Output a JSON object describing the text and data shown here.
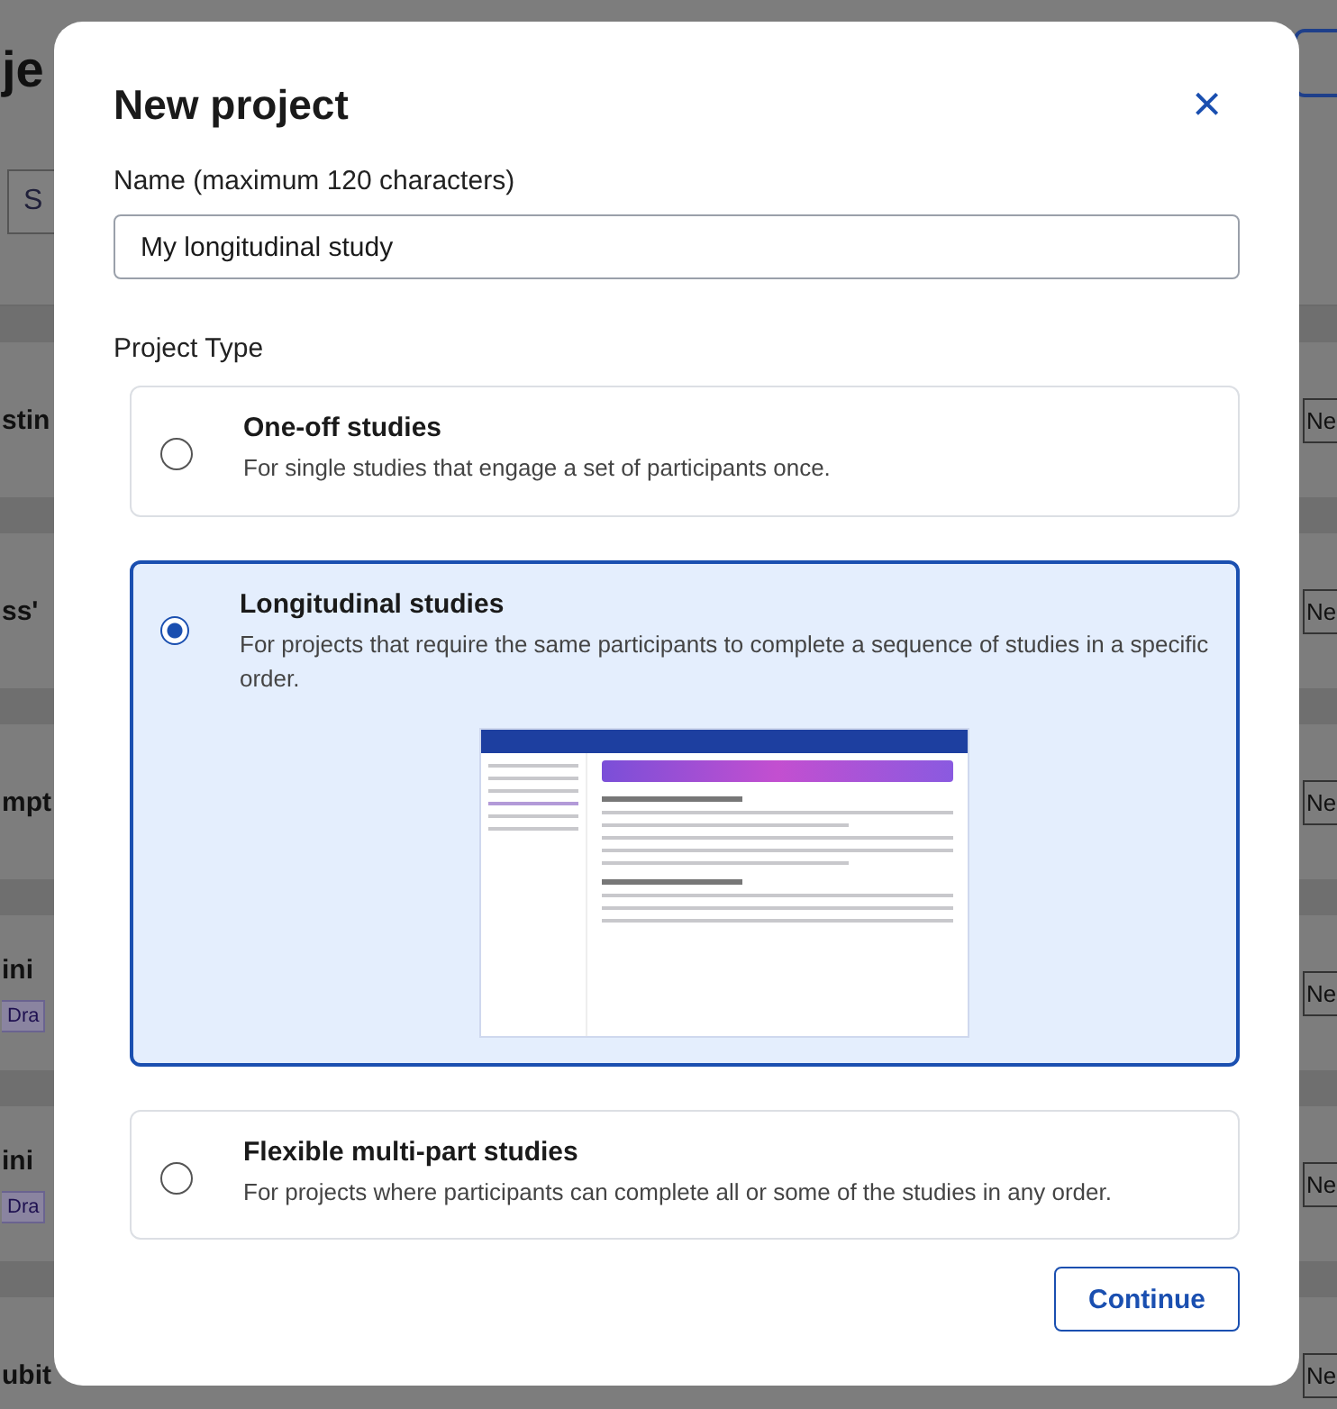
{
  "background": {
    "title": "je",
    "search": {
      "placeholder": "S"
    },
    "rows": [
      {
        "name": "stin",
        "status": "Ne"
      },
      {
        "name": "ss'",
        "status": "Ne"
      },
      {
        "name": "mpt",
        "status": "Ne"
      },
      {
        "name": "ini",
        "badge": "Dra",
        "status": "Ne"
      },
      {
        "name": "ini",
        "badge": "Dra",
        "status": "Ne"
      },
      {
        "name": "ubit",
        "status": "Ne"
      }
    ]
  },
  "dialog": {
    "title": "New project",
    "close": "×",
    "name_field": {
      "label": "Name (maximum 120 characters)",
      "value": "My longitudinal study"
    },
    "type_label": "Project Type",
    "options": [
      {
        "title": "One-off studies",
        "description": "For single studies that engage a set of participants once.",
        "selected": false
      },
      {
        "title": "Longitudinal studies",
        "description": "For projects that require the same participants to complete a sequence of studies in a specific order.",
        "selected": true
      },
      {
        "title": "Flexible multi-part studies",
        "description": "For projects where participants can complete all or some of the studies in any order.",
        "selected": false
      }
    ],
    "continue": "Continue"
  }
}
